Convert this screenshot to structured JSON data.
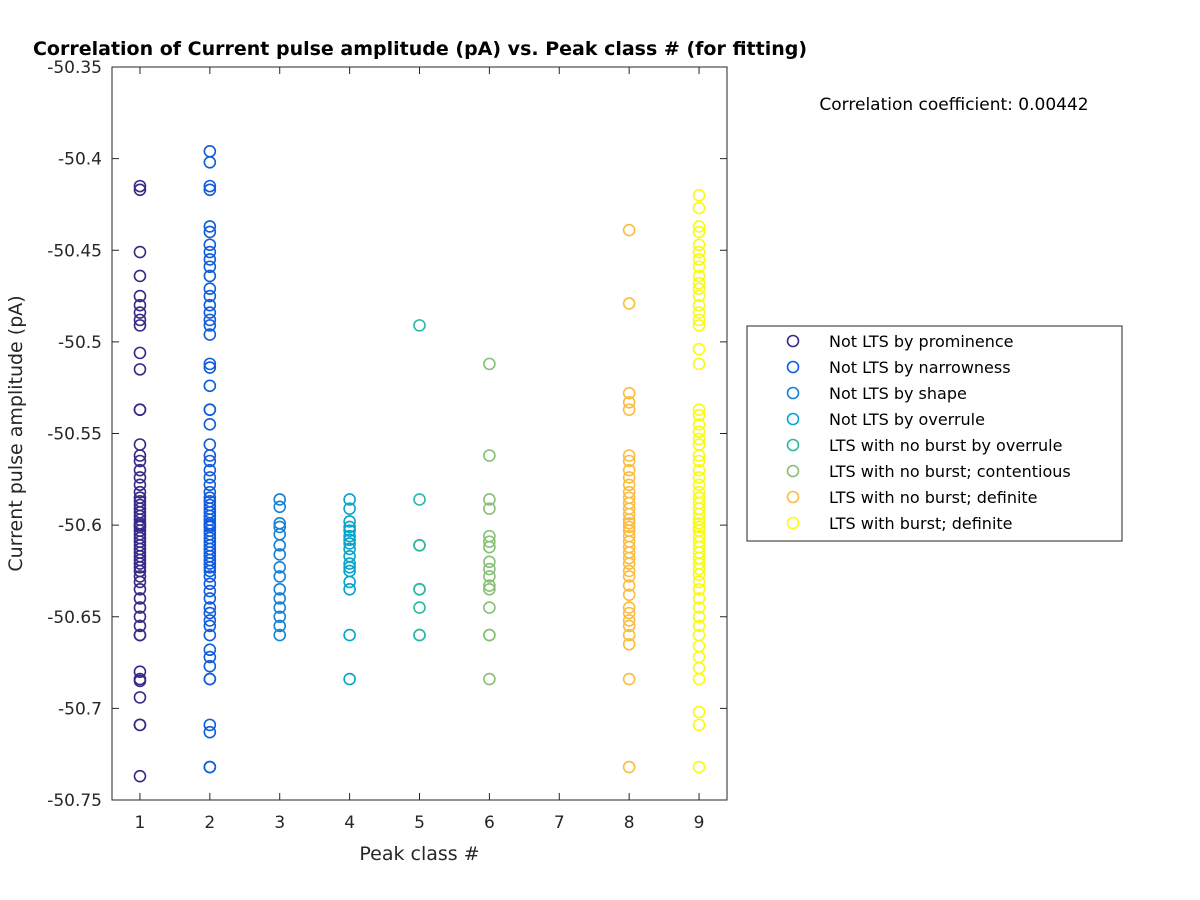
{
  "chart_data": {
    "type": "scatter",
    "title": "Correlation of Current pulse amplitude (pA) vs. Peak class # (for fitting)",
    "xlabel": "Peak class #",
    "ylabel": "Current pulse amplitude (pA)",
    "xlim": [
      0.6,
      9.4
    ],
    "ylim": [
      -50.75,
      -50.35
    ],
    "xticks": [
      1,
      2,
      3,
      4,
      5,
      6,
      7,
      8,
      9
    ],
    "xtick_labels": [
      "1",
      "2",
      "3",
      "4",
      "5",
      "6",
      "7",
      "8",
      "9"
    ],
    "yticks": [
      -50.75,
      -50.7,
      -50.65,
      -50.6,
      -50.55,
      -50.5,
      -50.45,
      -50.4,
      -50.35
    ],
    "ytick_labels": [
      "-50.75",
      "-50.7",
      "-50.65",
      "-50.6",
      "-50.55",
      "-50.5",
      "-50.45",
      "-50.4",
      "-50.35"
    ],
    "grid": false,
    "marker": "open-circle",
    "annotation": "Correlation coefficient: 0.00442",
    "legend_position": "right",
    "series": [
      {
        "name": "Not LTS by prominence",
        "color": "#352a87",
        "x": 1,
        "y": [
          -50.415,
          -50.417,
          -50.451,
          -50.464,
          -50.475,
          -50.48,
          -50.484,
          -50.488,
          -50.491,
          -50.506,
          -50.515,
          -50.537,
          -50.537,
          -50.556,
          -50.562,
          -50.565,
          -50.57,
          -50.574,
          -50.578,
          -50.582,
          -50.585,
          -50.587,
          -50.589,
          -50.591,
          -50.593,
          -50.595,
          -50.597,
          -50.599,
          -50.6,
          -50.601,
          -50.603,
          -50.605,
          -50.607,
          -50.609,
          -50.611,
          -50.613,
          -50.615,
          -50.617,
          -50.619,
          -50.621,
          -50.623,
          -50.625,
          -50.628,
          -50.631,
          -50.635,
          -50.64,
          -50.645,
          -50.65,
          -50.655,
          -50.66,
          -50.66,
          -50.68,
          -50.684,
          -50.685,
          -50.694,
          -50.709,
          -50.709,
          -50.737
        ]
      },
      {
        "name": "Not LTS by narrowness",
        "color": "#0f5cdd",
        "x": 2,
        "y": [
          -50.396,
          -50.402,
          -50.415,
          -50.417,
          -50.437,
          -50.44,
          -50.447,
          -50.451,
          -50.455,
          -50.459,
          -50.464,
          -50.471,
          -50.475,
          -50.48,
          -50.484,
          -50.488,
          -50.491,
          -50.496,
          -50.512,
          -50.514,
          -50.524,
          -50.537,
          -50.537,
          -50.545,
          -50.556,
          -50.562,
          -50.565,
          -50.57,
          -50.574,
          -50.578,
          -50.582,
          -50.585,
          -50.587,
          -50.589,
          -50.591,
          -50.593,
          -50.595,
          -50.597,
          -50.599,
          -50.6,
          -50.601,
          -50.603,
          -50.605,
          -50.607,
          -50.609,
          -50.611,
          -50.613,
          -50.615,
          -50.617,
          -50.619,
          -50.621,
          -50.623,
          -50.625,
          -50.628,
          -50.632,
          -50.636,
          -50.64,
          -50.645,
          -50.648,
          -50.652,
          -50.655,
          -50.66,
          -50.668,
          -50.672,
          -50.677,
          -50.684,
          -50.684,
          -50.709,
          -50.713,
          -50.732,
          -50.732
        ]
      },
      {
        "name": "Not LTS by shape",
        "color": "#1481d6",
        "x": 3,
        "y": [
          -50.586,
          -50.59,
          -50.599,
          -50.601,
          -50.605,
          -50.611,
          -50.616,
          -50.623,
          -50.628,
          -50.635,
          -50.64,
          -50.645,
          -50.65,
          -50.655,
          -50.66
        ]
      },
      {
        "name": "Not LTS by overrule",
        "color": "#06a4ca",
        "x": 4,
        "y": [
          -50.586,
          -50.591,
          -50.598,
          -50.601,
          -50.603,
          -50.606,
          -50.608,
          -50.61,
          -50.613,
          -50.617,
          -50.621,
          -50.623,
          -50.625,
          -50.631,
          -50.635,
          -50.66,
          -50.684
        ]
      },
      {
        "name": "LTS with no burst by overrule",
        "color": "#2eb7a4",
        "x": 5,
        "y": [
          -50.491,
          -50.586,
          -50.611,
          -50.611,
          -50.635,
          -50.635,
          -50.645,
          -50.66,
          -50.66
        ]
      },
      {
        "name": "LTS with no burst; contentious",
        "color": "#87bf77",
        "x": 6,
        "y": [
          -50.512,
          -50.562,
          -50.586,
          -50.591,
          -50.606,
          -50.609,
          -50.612,
          -50.62,
          -50.624,
          -50.628,
          -50.633,
          -50.635,
          -50.645,
          -50.66,
          -50.66,
          -50.684
        ]
      },
      {
        "name": "LTS with no burst; definite",
        "color": "#fbbc3f",
        "x": 8,
        "y": [
          -50.439,
          -50.479,
          -50.528,
          -50.533,
          -50.537,
          -50.562,
          -50.565,
          -50.57,
          -50.574,
          -50.578,
          -50.582,
          -50.585,
          -50.588,
          -50.591,
          -50.594,
          -50.597,
          -50.599,
          -50.601,
          -50.603,
          -50.606,
          -50.609,
          -50.612,
          -50.615,
          -50.618,
          -50.621,
          -50.625,
          -50.628,
          -50.633,
          -50.638,
          -50.645,
          -50.648,
          -50.652,
          -50.655,
          -50.66,
          -50.665,
          -50.684,
          -50.732
        ]
      },
      {
        "name": "LTS with burst; definite",
        "color": "#f9fb0e",
        "x": 9,
        "y": [
          -50.42,
          -50.427,
          -50.437,
          -50.44,
          -50.447,
          -50.451,
          -50.455,
          -50.459,
          -50.464,
          -50.468,
          -50.471,
          -50.475,
          -50.48,
          -50.484,
          -50.488,
          -50.491,
          -50.504,
          -50.512,
          -50.537,
          -50.54,
          -50.545,
          -50.549,
          -50.553,
          -50.556,
          -50.562,
          -50.565,
          -50.57,
          -50.574,
          -50.578,
          -50.582,
          -50.585,
          -50.588,
          -50.591,
          -50.594,
          -50.597,
          -50.599,
          -50.601,
          -50.603,
          -50.606,
          -50.609,
          -50.612,
          -50.615,
          -50.618,
          -50.621,
          -50.624,
          -50.627,
          -50.631,
          -50.635,
          -50.64,
          -50.645,
          -50.65,
          -50.655,
          -50.66,
          -50.666,
          -50.672,
          -50.678,
          -50.684,
          -50.702,
          -50.709,
          -50.732
        ]
      }
    ]
  }
}
